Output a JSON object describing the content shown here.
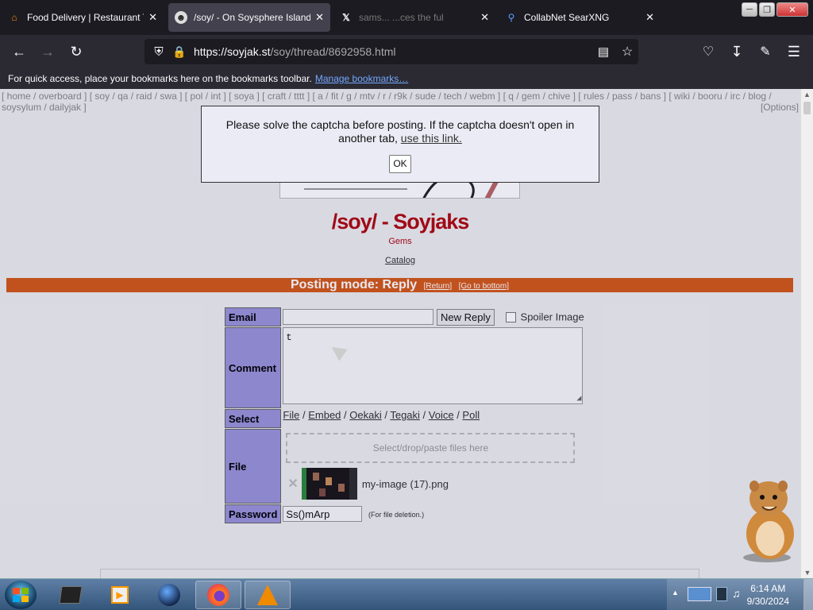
{
  "browser": {
    "tabs": [
      {
        "title": "Food Delivery | Restaurant Ta",
        "icon": "food-delivery-favicon",
        "active": false
      },
      {
        "title": "/soy/ - On Soysphere Island",
        "icon": "soyjak-favicon",
        "active": true
      },
      {
        "title": "sams... ...ces the ful",
        "icon": "x-favicon",
        "active": false
      },
      {
        "title": "CollabNet SearXNG",
        "icon": "search-favicon",
        "active": false
      }
    ],
    "url_host": "https://soyjak.st",
    "url_path": "/soy/thread/8692958.html",
    "bookmarks_text": "For quick access, place your bookmarks here on the bookmarks toolbar.",
    "bookmarks_link": "Manage bookmarks…"
  },
  "page": {
    "boardlist_line1": "[ home / overboard ] [ soy / qa / raid / swa ] [ pol / int ] [ soya ] [ craft / tttt ] [ a / fit / g / mtv / r / r9k / sude / tech / webm ] [ q / gem / chive ] [ rules / pass / bans ] [ wiki / booru / irc / blog /",
    "boardlist_line2": "soysylum / dailyjak ]",
    "options": "[Options]",
    "board_title": "/soy/ - Soyjaks",
    "board_subtitle": "Gems",
    "catalog": "Catalog",
    "posting_mode": "Posting mode: Reply",
    "return_link": "[Return]",
    "bottom_link": "[Go to bottom]",
    "form": {
      "email_label": "Email",
      "email_value": "",
      "new_reply_button": "New Reply",
      "spoiler_label": "Spoiler Image",
      "comment_label": "Comment",
      "comment_value": "t",
      "select_label": "Select",
      "select_links": [
        "File",
        "Embed",
        "Oekaki",
        "Tegaki",
        "Voice",
        "Poll"
      ],
      "file_label": "File",
      "dropzone_text": "Select/drop/paste files here",
      "file_name": "my-image (17).png",
      "password_label": "Password",
      "password_value": "Ss()mArp",
      "password_hint": "(For file deletion.)"
    }
  },
  "modal": {
    "message_part1": "Please solve the captcha before posting. If the captcha doesn't open in another tab,",
    "message_link": "use this link.",
    "ok_button": "OK"
  },
  "taskbar": {
    "time": "6:14 AM",
    "date": "9/30/2024"
  },
  "colors": {
    "board_title": "#af0a0f",
    "posting_bar": "#d45a18",
    "form_header": "#9a94d8"
  }
}
